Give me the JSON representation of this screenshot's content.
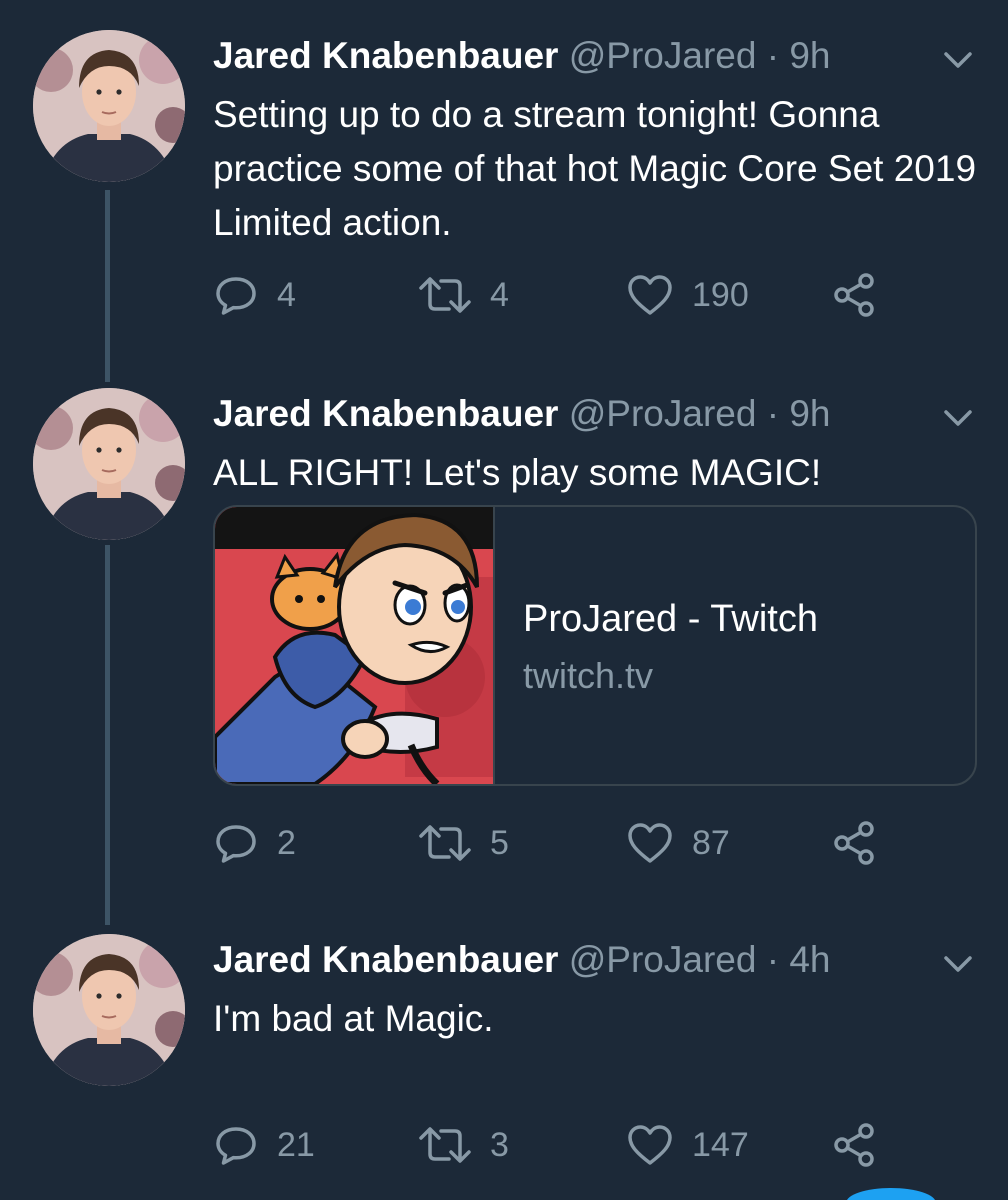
{
  "tweets": [
    {
      "name": "Jared Knabenbauer",
      "handle": "@ProJared",
      "separator": "·",
      "time": "9h",
      "text": "Setting up to do a stream tonight! Gonna practice some of that hot Magic Core Set 2019 Limited action.",
      "replies": "4",
      "retweets": "4",
      "likes": "190"
    },
    {
      "name": "Jared Knabenbauer",
      "handle": "@ProJared",
      "separator": "·",
      "time": "9h",
      "text": "ALL RIGHT! Let's play some MAGIC!",
      "card": {
        "title": "ProJared - Twitch",
        "domain": "twitch.tv"
      },
      "replies": "2",
      "retweets": "5",
      "likes": "87"
    },
    {
      "name": "Jared Knabenbauer",
      "handle": "@ProJared",
      "separator": "·",
      "time": "4h",
      "text": "I'm bad at Magic.",
      "replies": "21",
      "retweets": "3",
      "likes": "147"
    }
  ],
  "icons": {
    "reply": "reply-icon",
    "retweet": "retweet-icon",
    "like": "heart-icon",
    "share": "share-icon",
    "menu": "chevron-down-icon"
  },
  "colors": {
    "background": "#1c2938",
    "text": "#ffffff",
    "secondary": "#8899a6",
    "thread_line": "#3d5466",
    "card_border": "#38444d"
  }
}
